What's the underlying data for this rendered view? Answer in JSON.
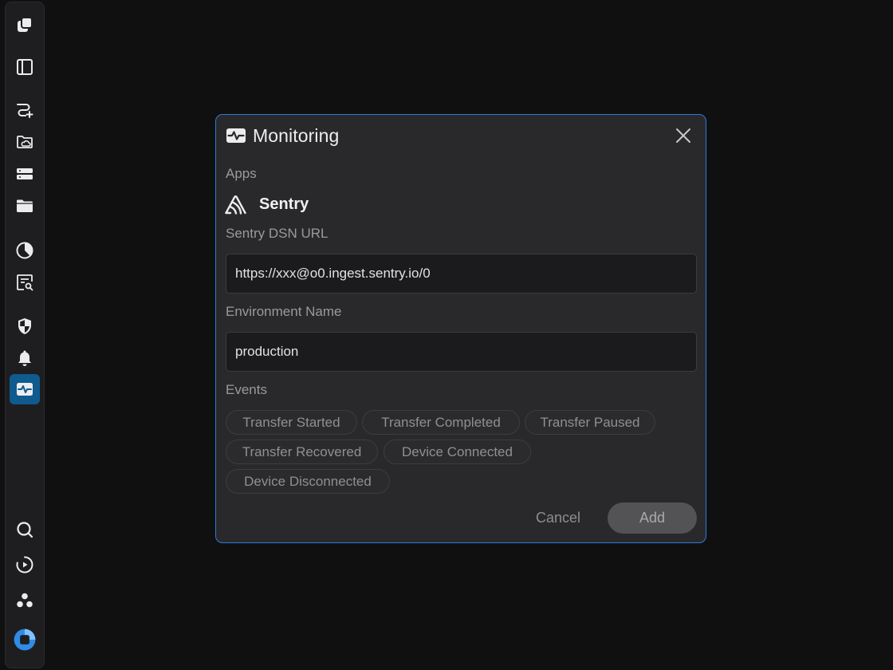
{
  "sidebar": {
    "items": [
      {
        "icon": "app-logo-icon"
      },
      {
        "icon": "panel-left-icon"
      },
      {
        "icon": "route-add-icon"
      },
      {
        "icon": "folder-cloud-icon"
      },
      {
        "icon": "storage-icon"
      },
      {
        "icon": "folder-icon"
      },
      {
        "icon": "pie-chart-icon"
      },
      {
        "icon": "log-search-icon"
      },
      {
        "icon": "shield-icon"
      },
      {
        "icon": "bell-icon"
      },
      {
        "icon": "monitoring-icon",
        "active": true
      },
      {
        "icon": "search-icon"
      },
      {
        "icon": "play-history-icon"
      },
      {
        "icon": "community-icon"
      },
      {
        "icon": "brand-logo-icon"
      }
    ]
  },
  "dialog": {
    "title": "Monitoring",
    "header_icon": "monitoring-icon",
    "close_icon": "close-icon",
    "apps_label": "Apps",
    "app": {
      "name": "Sentry",
      "icon": "sentry-logo-icon"
    },
    "dsn": {
      "label": "Sentry DSN URL",
      "value": "https://xxx@o0.ingest.sentry.io/0"
    },
    "environment": {
      "label": "Environment Name",
      "value": "production"
    },
    "events": {
      "label": "Events",
      "chips": [
        "Transfer Started",
        "Transfer Completed",
        "Transfer Paused",
        "Transfer Recovered",
        "Device Connected",
        "Device Disconnected"
      ]
    },
    "cancel_label": "Cancel",
    "add_label": "Add"
  },
  "colors": {
    "background": "#101011",
    "dialog": "#29292b",
    "dialog_border": "#2f7ad9",
    "active_nav": "#0f5a8f"
  }
}
